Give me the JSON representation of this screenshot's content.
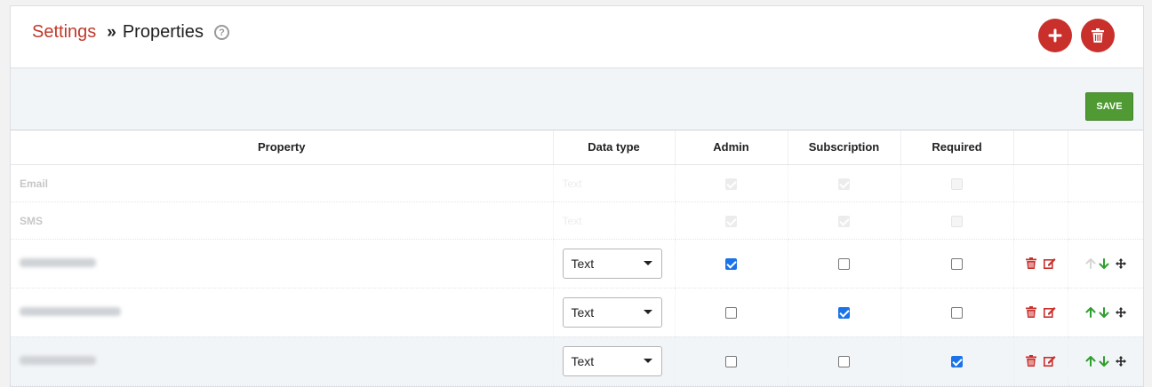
{
  "breadcrumb": {
    "parent": "Settings",
    "separator": "»",
    "current": "Properties",
    "help": "?"
  },
  "actions": {
    "add_symbol": "+",
    "save_label": "SAVE"
  },
  "table": {
    "columns": [
      "Property",
      "Data type",
      "Admin",
      "Subscription",
      "Required",
      "",
      ""
    ],
    "system_rows": [
      {
        "name": "Email",
        "type": "Text",
        "admin": true,
        "subscription": true,
        "required": false
      },
      {
        "name": "SMS",
        "type": "Text",
        "admin": true,
        "subscription": true,
        "required": false
      }
    ],
    "user_rows": [
      {
        "name_redacted": true,
        "type": "Text",
        "admin": true,
        "subscription": false,
        "required": false,
        "up_enabled": false
      },
      {
        "name_redacted": true,
        "type": "Text",
        "admin": false,
        "subscription": true,
        "required": false,
        "up_enabled": true
      },
      {
        "name_redacted": true,
        "type": "Text",
        "admin": false,
        "subscription": false,
        "required": true,
        "up_enabled": true
      }
    ]
  },
  "colors": {
    "brand_red": "#c9302c",
    "save_green": "#4f9a32",
    "arrow_green": "#2e9e2e",
    "checkbox_blue": "#1a73e8"
  }
}
